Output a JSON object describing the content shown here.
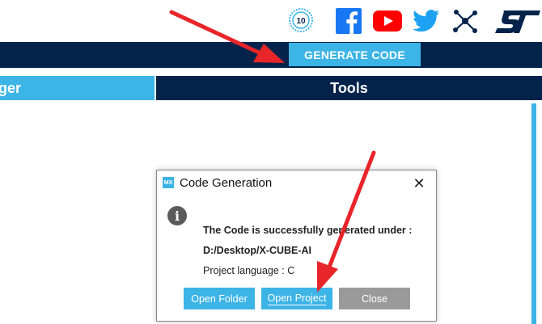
{
  "colors": {
    "navy": "#03234b",
    "accent": "#3cb4e6",
    "close_grey": "#9a9a9a",
    "arrow_red": "#e8262a",
    "facebook": "#1877f2",
    "youtube": "#ff0000",
    "twitter": "#1da1f2"
  },
  "header": {
    "badge_text": "10",
    "icons": [
      "anniversary-badge-icon",
      "facebook-icon",
      "youtube-icon",
      "twitter-icon",
      "network-icon",
      "st-logo"
    ]
  },
  "toolbar": {
    "generate_label": "GENERATE CODE"
  },
  "tabs": [
    {
      "label": "ger",
      "active": true
    },
    {
      "label": "Tools",
      "active": false
    }
  ],
  "dialog": {
    "app_badge": "MX",
    "title": "Code Generation",
    "close_glyph": "✕",
    "message_line1": "The Code is successfully generated under :",
    "message_path": "D:/Desktop/X-CUBE-AI",
    "message_language": "Project language : C",
    "buttons": {
      "open_folder": "Open Folder",
      "open_project": "Open Project",
      "close": "Close"
    }
  }
}
